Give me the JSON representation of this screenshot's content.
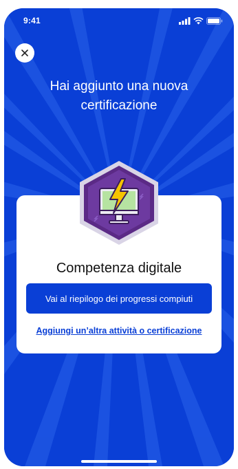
{
  "status_bar": {
    "time": "9:41"
  },
  "icons": {
    "close": "close-icon",
    "signal": "signal-icon",
    "wifi": "wifi-icon",
    "battery": "battery-icon",
    "badge": "digital-skills-badge-icon"
  },
  "header": {
    "title": "Hai aggiunto una nuova certificazione"
  },
  "card": {
    "certification_name": "Competenza digitale",
    "primary_button_label": "Vai al riepilogo dei progressi compiuti",
    "secondary_link_label": "Aggiungi un’altra attività o certificazione"
  },
  "colors": {
    "background": "#0a3fd6",
    "badge_outer": "#5b2a86",
    "badge_inner": "#b6e3a1",
    "lightning": "#f5c400"
  }
}
